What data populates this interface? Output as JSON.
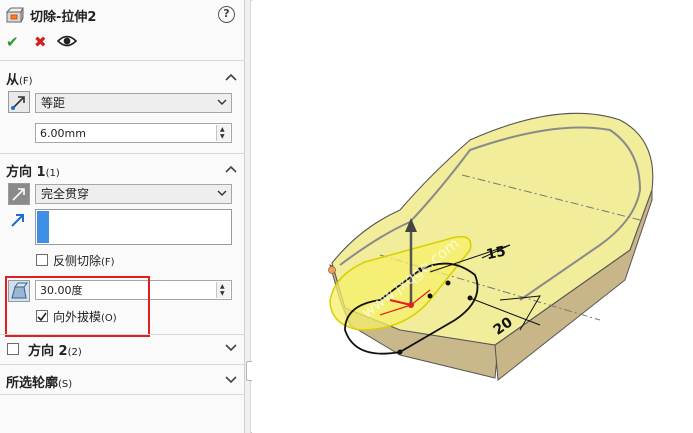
{
  "panel": {
    "title": "切除-拉伸2",
    "help_label": "?",
    "ok_icon": "check-icon",
    "cancel_icon": "close-icon",
    "preview_icon": "eye-icon",
    "from": {
      "title": "从",
      "title_hotkey": "(F)",
      "start_condition": "等距",
      "offset_value": "6.00mm"
    },
    "direction1": {
      "title": "方向 1",
      "title_hotkey": "(1)",
      "end_condition": "完全贯穿",
      "flip_side_label": "反侧切除",
      "flip_side_hotkey": "(F)",
      "flip_side_checked": false,
      "draft_angle": "30.00度",
      "draft_outward_label": "向外拔模",
      "draft_outward_hotkey": "(O)",
      "draft_outward_checked": true
    },
    "direction2": {
      "title": "方向 2",
      "title_hotkey": "(2)",
      "checked": false
    },
    "selected_contours": {
      "title": "所选轮廓",
      "title_hotkey": "(S)"
    }
  },
  "viewport": {
    "dimension_1": "15",
    "dimension_2": "20",
    "watermark": "www.jxqge.com",
    "model_color": "#f2ed9a",
    "highlight_color": "#e02020"
  }
}
